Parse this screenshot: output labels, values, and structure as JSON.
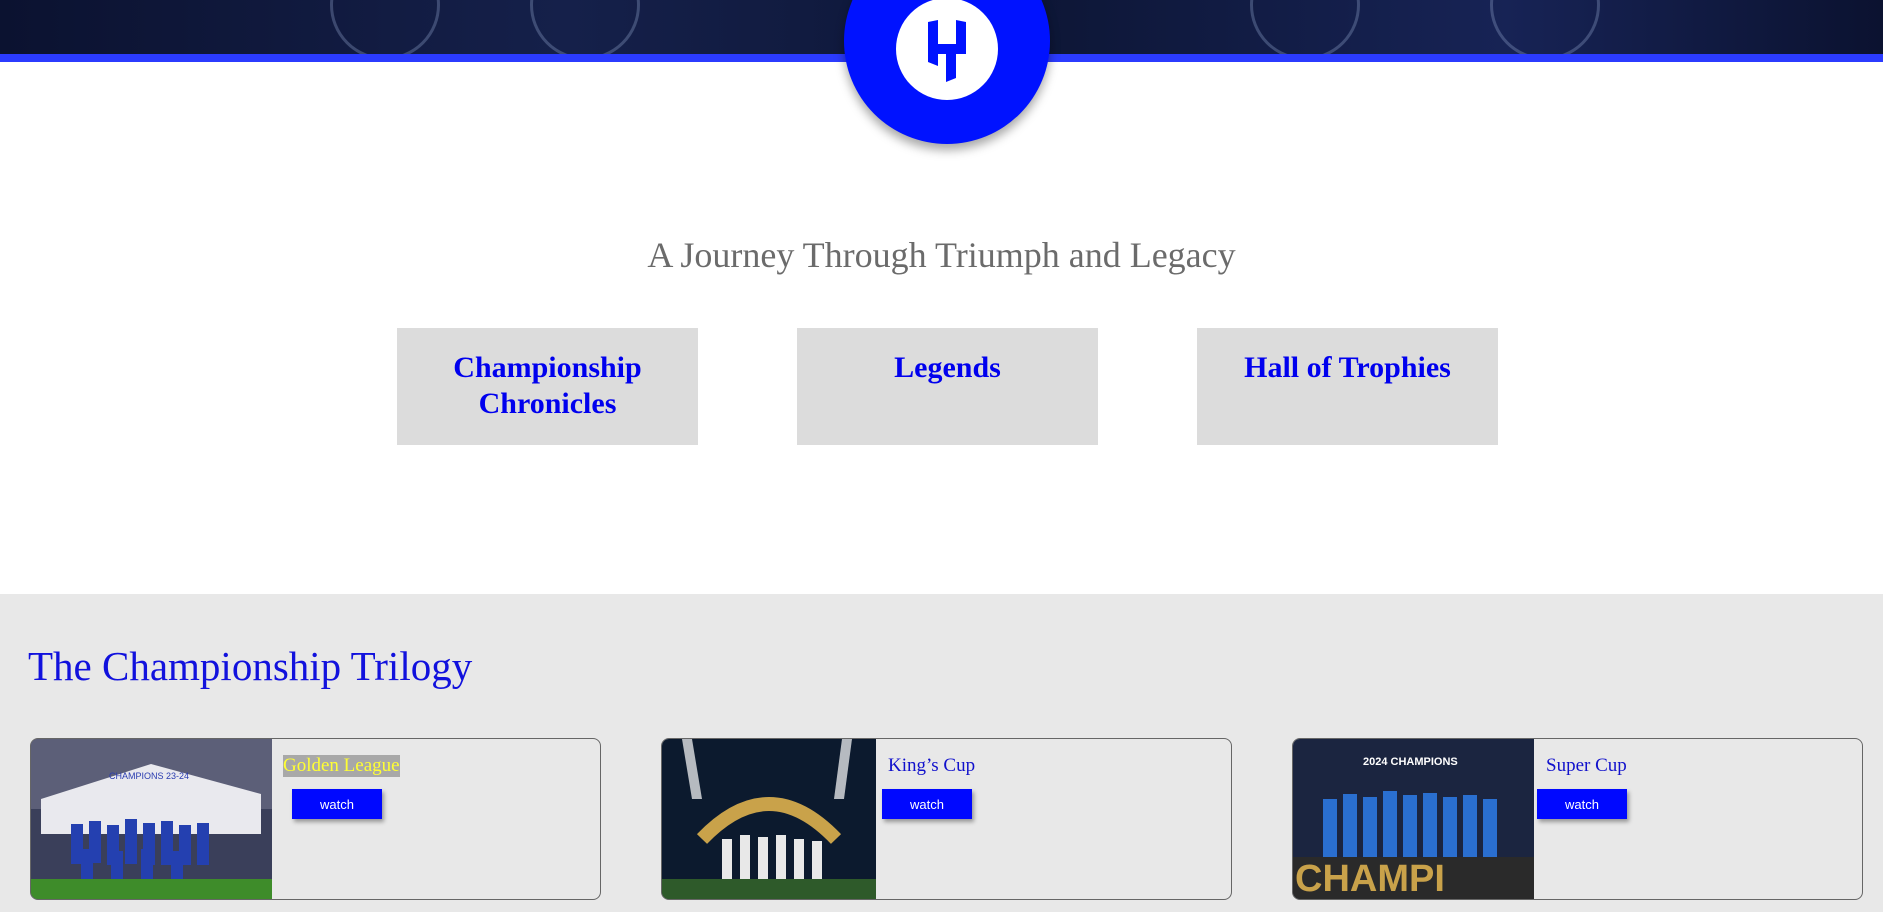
{
  "header": {
    "logo": "al-hilal-logo-icon",
    "tagline": "A Journey Through Triumph and Legacy"
  },
  "nav": {
    "cards": [
      {
        "label": "Championship Chronicles"
      },
      {
        "label": "Legends"
      },
      {
        "label": "Hall of Trophies"
      }
    ]
  },
  "trilogy": {
    "title": "The Championship Trilogy",
    "cards": [
      {
        "name": "Golden League",
        "button": "watch",
        "photo": "team-celebration-photo",
        "photo_text": "CHAMPIONS 23-24"
      },
      {
        "name": "King’s Cup",
        "button": "watch",
        "photo": "trophy-ceremony-photo"
      },
      {
        "name": "Super Cup",
        "button": "watch",
        "photo": "champions-podium-photo",
        "photo_text": "2024 CHAMPIONS",
        "photo_banner": "CHAMPI"
      }
    ]
  },
  "colors": {
    "brand_blue": "#0012ff",
    "link_blue": "#0000ee",
    "card_gray": "#dcdcdc",
    "section_gray": "#e8e8e8"
  }
}
